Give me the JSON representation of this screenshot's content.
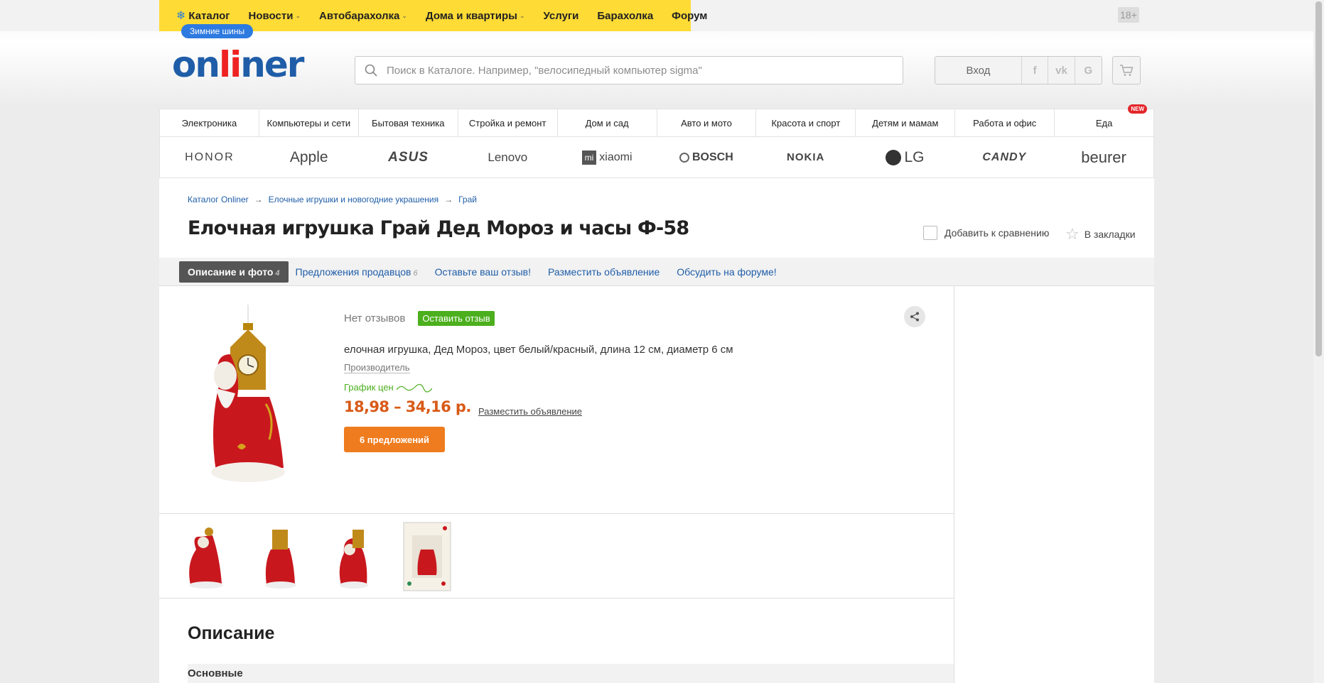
{
  "topnav": {
    "catalog": "Каталог",
    "items": [
      {
        "label": "Новости",
        "caret": true
      },
      {
        "label": "Автобарахолка",
        "caret": true
      },
      {
        "label": "Дома и квартиры",
        "caret": true
      },
      {
        "label": "Услуги",
        "caret": false
      },
      {
        "label": "Барахолка",
        "caret": false
      },
      {
        "label": "Форум",
        "caret": false
      }
    ],
    "winter_badge": "Зимние шины",
    "age": "18+"
  },
  "logo": {
    "part1": "on",
    "part2": "li",
    "part3": "ner"
  },
  "search": {
    "placeholder": "Поиск в Каталоге. Например, \"велосипедный компьютер sigma\""
  },
  "auth": {
    "login": "Вход",
    "social": [
      "f",
      "vk",
      "G"
    ]
  },
  "categories": [
    "Электроника",
    "Компьютеры и сети",
    "Бытовая техника",
    "Стройка и ремонт",
    "Дом и сад",
    "Авто и мото",
    "Красота и спорт",
    "Детям и мамам",
    "Работа и офис",
    "Еда"
  ],
  "new_badge": "NEW",
  "brands": [
    "HONOR",
    "Apple",
    "ASUS",
    "Lenovo",
    "xiaomi",
    "BOSCH",
    "NOKIA",
    "LG",
    "CANDY",
    "beurer"
  ],
  "breadcrumb": [
    "Каталог Onliner",
    "Елочные игрушки и новогодние украшения",
    "Грай"
  ],
  "breadcrumb_sep": "→",
  "product": {
    "title": "Елочная игрушка Грай Дед Мороз и часы Ф-58",
    "compare": "Добавить к сравнению",
    "bookmark": "В закладки",
    "reviews_none": "Нет отзывов",
    "leave_review": "Оставить отзыв",
    "description": "елочная игрушка, Дед Мороз, цвет белый/красный, длина 12 см, диаметр 6 см",
    "manufacturer": "Производитель",
    "price_graph": "График цен",
    "price": "18,98 – 34,16 р.",
    "place_ad": "Разместить объявление",
    "offers_button": "6 предложений"
  },
  "tabs": [
    {
      "label": "Описание и фото",
      "count": "4",
      "active": true
    },
    {
      "label": "Предложения продавцов",
      "count": "6",
      "active": false
    },
    {
      "label": "Оставьте ваш отзыв!",
      "count": "",
      "active": false
    },
    {
      "label": "Разместить объявление",
      "count": "",
      "active": false
    },
    {
      "label": "Обсудить на форуме!",
      "count": "",
      "active": false
    }
  ],
  "section": {
    "heading": "Описание",
    "group": "Основные"
  },
  "colors": {
    "yellow": "#ffdb35",
    "link": "#1f5da8",
    "price": "#d85a17",
    "orange": "#ef7c1e",
    "green": "#4caf1e"
  }
}
